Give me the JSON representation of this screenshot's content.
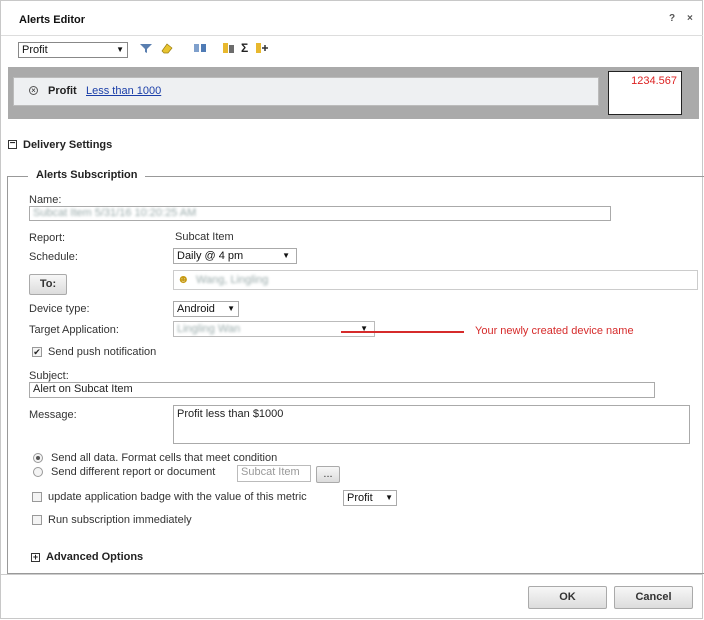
{
  "window": {
    "title": "Alerts Editor",
    "help": "?",
    "close": "×"
  },
  "toolbar": {
    "metric": "Profit"
  },
  "condition": {
    "metric": "Profit",
    "rule": "Less than 1000",
    "preview_value": "1234.567"
  },
  "delivery": {
    "section_title": "Delivery Settings",
    "group_title": "Alerts Subscription"
  },
  "form": {
    "name_label": "Name:",
    "name_value": "Subcat Item 5/31/16 10:20:25 AM",
    "report_label": "Report:",
    "report_value": "Subcat Item",
    "schedule_label": "Schedule:",
    "schedule_value": "Daily @ 4 pm",
    "to_button": "To:",
    "to_value": "Wang, Lingling",
    "device_label": "Device type:",
    "device_value": "Android",
    "target_label": "Target Application:",
    "target_value": "Lingling Wan",
    "annotation": "Your newly created device name",
    "push_label": "Send push notification",
    "subject_label": "Subject:",
    "subject_value": "Alert on Subcat Item",
    "message_label": "Message:",
    "message_value": "Profit less than $1000",
    "send_all": "Send all data. Format cells that meet condition",
    "send_diff": "Send different report or document",
    "diff_report": "Subcat Item",
    "browse": "...",
    "badge_label": "update application badge with the value of this metric",
    "badge_metric": "Profit",
    "run_label": "Run subscription immediately",
    "advanced": "Advanced Options"
  },
  "buttons": {
    "ok": "OK",
    "cancel": "Cancel"
  },
  "colors": {
    "annotation": "#d62b2b",
    "preview": "#dd2222"
  }
}
